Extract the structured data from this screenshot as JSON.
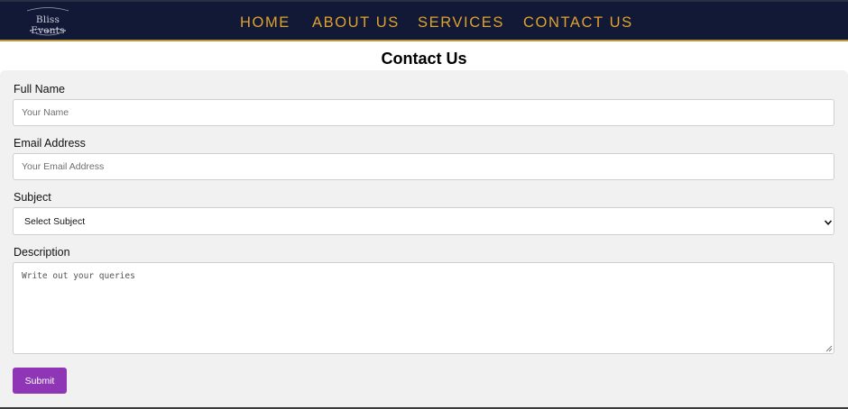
{
  "brand": {
    "logo_text": "Bliss Events"
  },
  "nav": {
    "items": [
      {
        "label": "HOME"
      },
      {
        "label": "ABOUT US"
      },
      {
        "label": "SERVICES"
      },
      {
        "label": "CONTACT US"
      }
    ]
  },
  "page": {
    "title": "Contact Us"
  },
  "form": {
    "full_name": {
      "label": "Full Name",
      "placeholder": "Your Name",
      "value": ""
    },
    "email": {
      "label": "Email Address",
      "placeholder": "Your Email Address",
      "value": ""
    },
    "subject": {
      "label": "Subject",
      "selected": "Select Subject"
    },
    "description": {
      "label": "Description",
      "placeholder": "Write out your queries",
      "value": ""
    },
    "submit_label": "Submit"
  },
  "colors": {
    "navbar_bg": "#111936",
    "nav_link": "#e0a22c",
    "nav_border": "#b89a3a",
    "submit_bg": "#8e36b6",
    "panel_bg": "#f1f1f1"
  }
}
